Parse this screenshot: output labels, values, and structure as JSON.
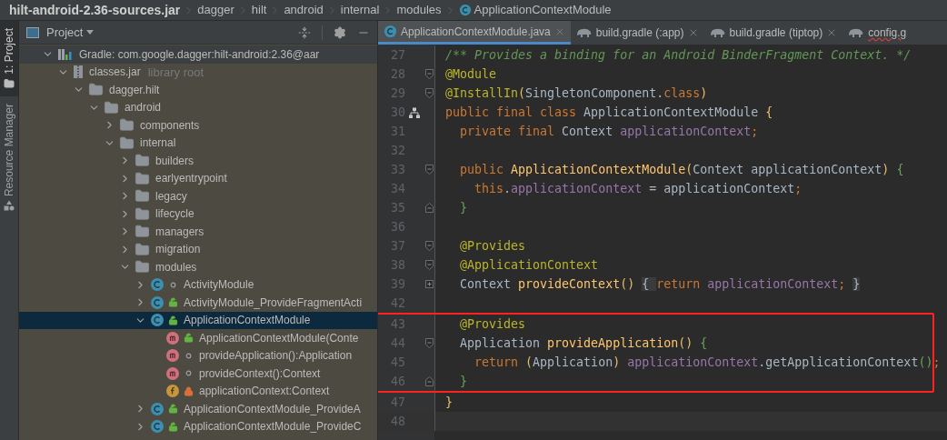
{
  "breadcrumbs": [
    {
      "label": "hilt-android-2.36-sources.jar",
      "kind": "root"
    },
    {
      "label": "dagger",
      "kind": "package"
    },
    {
      "label": "hilt",
      "kind": "package"
    },
    {
      "label": "android",
      "kind": "package"
    },
    {
      "label": "internal",
      "kind": "package"
    },
    {
      "label": "modules",
      "kind": "package"
    },
    {
      "label": "ApplicationContextModule",
      "kind": "class"
    }
  ],
  "tool_strip": [
    {
      "label": "1: Project",
      "selected": true
    },
    {
      "label": "Resource Manager",
      "selected": false
    }
  ],
  "project_panel": {
    "title": "Project",
    "tree": [
      {
        "label": "Gradle: com.google.dagger:hilt-android:2.36@aar",
        "kind": "gradle",
        "expanded": true,
        "selected": false,
        "children": [
          {
            "label": "classes.jar",
            "hint": "library root",
            "kind": "jar",
            "expanded": true,
            "selected": false,
            "children": [
              {
                "label": "dagger.hilt",
                "kind": "folder",
                "expanded": true,
                "selected": false,
                "children": [
                  {
                    "label": "android",
                    "kind": "folder",
                    "expanded": true,
                    "selected": false,
                    "children": [
                      {
                        "label": "components",
                        "kind": "folder",
                        "expanded": false,
                        "selected": false
                      },
                      {
                        "label": "internal",
                        "kind": "folder",
                        "expanded": true,
                        "selected": false,
                        "children": [
                          {
                            "label": "builders",
                            "kind": "folder",
                            "expanded": false,
                            "selected": false
                          },
                          {
                            "label": "earlyentrypoint",
                            "kind": "folder",
                            "expanded": false,
                            "selected": false
                          },
                          {
                            "label": "legacy",
                            "kind": "folder",
                            "expanded": false,
                            "selected": false
                          },
                          {
                            "label": "lifecycle",
                            "kind": "folder",
                            "expanded": false,
                            "selected": false
                          },
                          {
                            "label": "managers",
                            "kind": "folder",
                            "expanded": false,
                            "selected": false
                          },
                          {
                            "label": "migration",
                            "kind": "folder",
                            "expanded": false,
                            "selected": false
                          },
                          {
                            "label": "modules",
                            "kind": "folder",
                            "expanded": true,
                            "selected": false,
                            "children": [
                              {
                                "label": "ActivityModule",
                                "kind": "class",
                                "public": false,
                                "private": false,
                                "expanded": false,
                                "selected": false
                              },
                              {
                                "label": "ActivityModule_ProvideFragmentActi",
                                "kind": "class",
                                "public": true,
                                "private": false,
                                "expanded": false,
                                "selected": false
                              },
                              {
                                "label": "ApplicationContextModule",
                                "kind": "class",
                                "public": true,
                                "private": false,
                                "expanded": true,
                                "selected": true,
                                "children": [
                                  {
                                    "label": "ApplicationContextModule(Conte",
                                    "kind": "method",
                                    "public": true,
                                    "private": false,
                                    "selected": false
                                  },
                                  {
                                    "label": "provideApplication():Application",
                                    "kind": "method",
                                    "public": false,
                                    "private": false,
                                    "selected": false
                                  },
                                  {
                                    "label": "provideContext():Context",
                                    "kind": "method",
                                    "public": false,
                                    "private": false,
                                    "selected": false
                                  },
                                  {
                                    "label": "applicationContext:Context",
                                    "kind": "field",
                                    "public": false,
                                    "private": true,
                                    "selected": false
                                  }
                                ]
                              },
                              {
                                "label": "ApplicationContextModule_ProvideA",
                                "kind": "class",
                                "public": true,
                                "private": false,
                                "expanded": false,
                                "selected": false
                              },
                              {
                                "label": "ApplicationContextModule_ProvideC",
                                "kind": "class",
                                "public": true,
                                "private": false,
                                "expanded": false,
                                "selected": false
                              }
                            ]
                          }
                        ]
                      }
                    ]
                  }
                ]
              }
            ]
          }
        ]
      }
    ]
  },
  "editor_tabs": [
    {
      "label": "ApplicationContextModule.java",
      "kind": "class",
      "selected": true,
      "closable": true,
      "error": false
    },
    {
      "label": "build.gradle (:app)",
      "kind": "gradle",
      "selected": false,
      "closable": true,
      "error": false
    },
    {
      "label": "build.gradle (tiptop)",
      "kind": "gradle",
      "selected": false,
      "closable": true,
      "error": false
    },
    {
      "label": "config.g",
      "kind": "gradle",
      "selected": false,
      "closable": false,
      "error": true
    }
  ],
  "code_lines": [
    {
      "number": "27",
      "tokens": [
        {
          "kind": "comment",
          "text": "/** Provides a binding for an Android BinderFragment Context. */"
        }
      ]
    },
    {
      "number": "28",
      "fold_start": true,
      "tokens": [
        {
          "kind": "annotation",
          "text": "@Module"
        }
      ]
    },
    {
      "number": "29",
      "fold_start": true,
      "tokens": [
        {
          "kind": "annotation",
          "text": "@InstallIn"
        },
        {
          "kind": "paren",
          "text": "("
        },
        {
          "kind": "plain",
          "text": "SingletonComponent."
        },
        {
          "kind": "keyword",
          "text": "class"
        },
        {
          "kind": "paren",
          "text": ")"
        }
      ]
    },
    {
      "number": "30",
      "has_subclasses": true,
      "tokens": [
        {
          "kind": "keyword",
          "text": "public final class "
        },
        {
          "kind": "plain",
          "text": "ApplicationContextModule "
        },
        {
          "kind": "paren",
          "text": "{"
        }
      ]
    },
    {
      "number": "31",
      "tokens": [
        {
          "kind": "keyword",
          "text": "  private final "
        },
        {
          "kind": "plain",
          "text": "Context "
        },
        {
          "kind": "field",
          "text": "applicationContext"
        },
        {
          "kind": "keyword",
          "text": ";"
        }
      ]
    },
    {
      "number": "32"
    },
    {
      "number": "33",
      "fold_start": true,
      "tokens": [
        {
          "kind": "keyword",
          "text": "  public "
        },
        {
          "kind": "method",
          "text": "ApplicationContextModule"
        },
        {
          "kind": "paren",
          "text": "("
        },
        {
          "kind": "plain",
          "text": "Context applicationContext"
        },
        {
          "kind": "paren",
          "text": ") "
        },
        {
          "kind": "brace",
          "text": "{"
        }
      ]
    },
    {
      "number": "34",
      "tokens": [
        {
          "kind": "keyword",
          "text": "    this"
        },
        {
          "kind": "plain",
          "text": "."
        },
        {
          "kind": "field",
          "text": "applicationContext"
        },
        {
          "kind": "plain",
          "text": " = applicationContext"
        },
        {
          "kind": "keyword",
          "text": ";"
        }
      ]
    },
    {
      "number": "35",
      "fold_end": true,
      "tokens": [
        {
          "kind": "brace",
          "text": "  }"
        }
      ]
    },
    {
      "number": "36"
    },
    {
      "number": "37",
      "fold_start": true,
      "tokens": [
        {
          "kind": "annotation",
          "text": "  @Provides"
        }
      ]
    },
    {
      "number": "38",
      "fold_start": true,
      "tokens": [
        {
          "kind": "annotation",
          "text": "  @ApplicationContext"
        }
      ]
    },
    {
      "number": "39",
      "folded": true,
      "tokens": [
        {
          "kind": "plain",
          "text": "  Context "
        },
        {
          "kind": "method",
          "text": "provideContext"
        },
        {
          "kind": "paren",
          "text": "() "
        },
        {
          "kind": "folded",
          "text": "{ "
        },
        {
          "kind": "keyword",
          "text": "return "
        },
        {
          "kind": "field",
          "text": "applicationContext"
        },
        {
          "kind": "keyword",
          "text": "; "
        },
        {
          "kind": "folded",
          "text": "}"
        }
      ]
    },
    {
      "number": "42"
    },
    {
      "number": "43",
      "boxed": true,
      "tokens": [
        {
          "kind": "annotation",
          "text": "  @Provides"
        }
      ]
    },
    {
      "number": "44",
      "boxed": true,
      "fold_start": true,
      "tokens": [
        {
          "kind": "plain",
          "text": "  Application "
        },
        {
          "kind": "method",
          "text": "provideApplication"
        },
        {
          "kind": "paren",
          "text": "() "
        },
        {
          "kind": "brace",
          "text": "{"
        }
      ]
    },
    {
      "number": "45",
      "boxed": true,
      "tokens": [
        {
          "kind": "keyword",
          "text": "    return "
        },
        {
          "kind": "paren",
          "text": "("
        },
        {
          "kind": "plain",
          "text": "Application"
        },
        {
          "kind": "paren",
          "text": ") "
        },
        {
          "kind": "field",
          "text": "applicationContext"
        },
        {
          "kind": "plain",
          "text": ".getApplicationContext"
        },
        {
          "kind": "brace",
          "text": "()"
        },
        {
          "kind": "keyword",
          "text": ";"
        }
      ]
    },
    {
      "number": "46",
      "boxed": true,
      "fold_end": true,
      "tokens": [
        {
          "kind": "brace",
          "text": "  }"
        }
      ]
    },
    {
      "number": "47",
      "tokens": [
        {
          "kind": "paren",
          "text": "}"
        }
      ]
    },
    {
      "number": "48",
      "current": true
    }
  ]
}
